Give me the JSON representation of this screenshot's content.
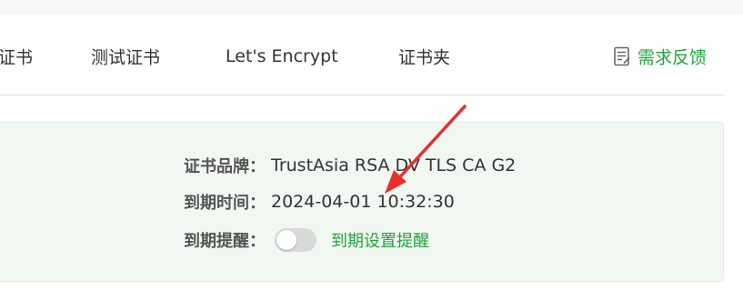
{
  "tabs": [
    {
      "label": "证书"
    },
    {
      "label": "测试证书"
    },
    {
      "label": "Let's Encrypt"
    },
    {
      "label": "证书夹"
    }
  ],
  "feedback": {
    "label": "需求反馈",
    "icon": "notepad-icon"
  },
  "cert": {
    "brand_label": "证书品牌：",
    "brand_value": "TrustAsia RSA DV TLS CA G2",
    "expiry_label": "到期时间：",
    "expiry_value": "2024-04-01 10:32:30",
    "reminder_label": "到期提醒：",
    "reminder_enabled": false,
    "reminder_link": "到期设置提醒"
  },
  "colors": {
    "accent_green": "#20a53a",
    "card_bg": "#f1f8f1",
    "arrow_red": "#e8302a"
  }
}
